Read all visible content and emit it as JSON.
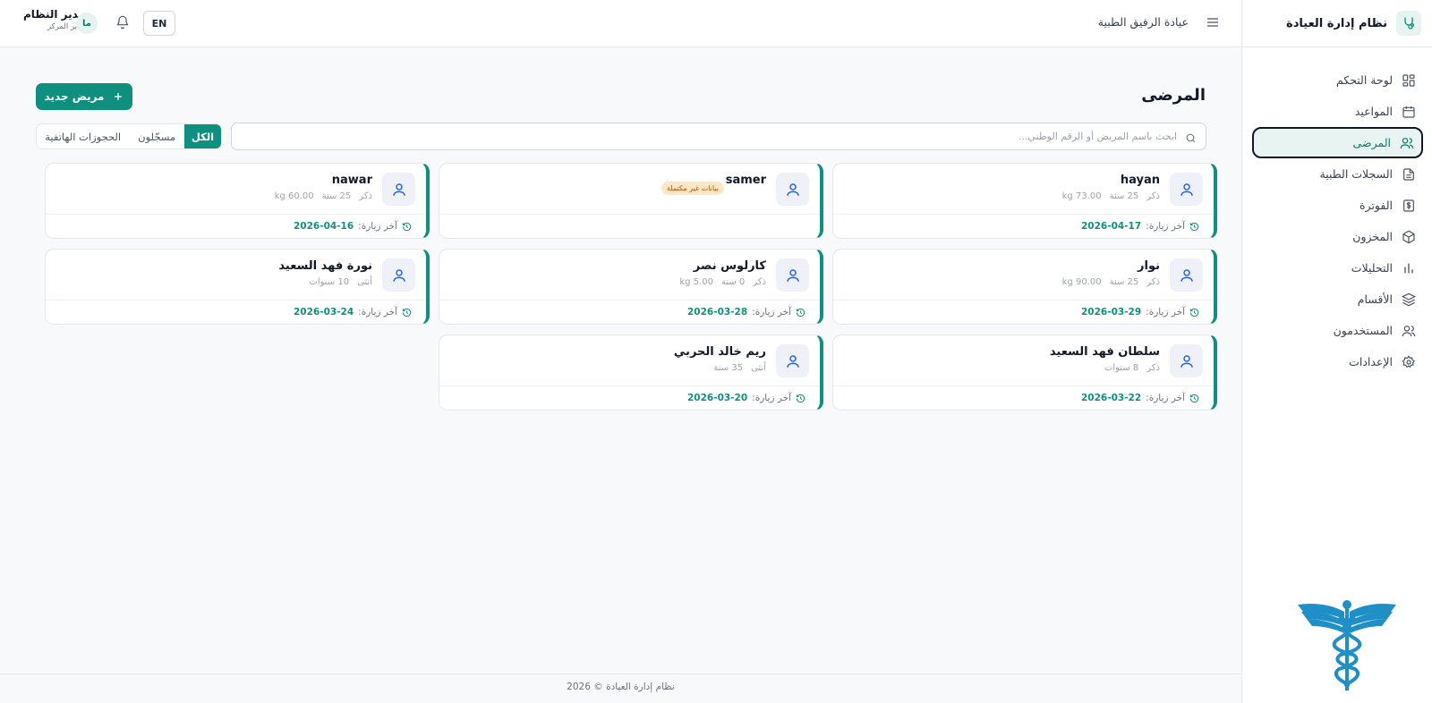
{
  "sidebar": {
    "app_title": "نظام إدارة العيادة",
    "items": [
      {
        "label": "لوحة التحكم",
        "icon": "dashboard-icon"
      },
      {
        "label": "المواعيد",
        "icon": "calendar-icon"
      },
      {
        "label": "المرضى",
        "icon": "users-icon",
        "active": true
      },
      {
        "label": "السجلات الطبية",
        "icon": "document-icon"
      },
      {
        "label": "الفوترة",
        "icon": "dollar-icon"
      },
      {
        "label": "المخزون",
        "icon": "box-icon"
      },
      {
        "label": "التحليلات",
        "icon": "bar-chart-icon"
      },
      {
        "label": "الأقسام",
        "icon": "layers-icon"
      },
      {
        "label": "المستخدمون",
        "icon": "users-icon"
      },
      {
        "label": "الإعدادات",
        "icon": "gear-icon"
      }
    ]
  },
  "header": {
    "clinic_name": "عيادة الرفيق الطبية",
    "lang_button": "EN",
    "user_name": "مدير النظام",
    "user_role": "مدير المركز",
    "avatar_initials": "ما"
  },
  "main": {
    "title": "المرضى",
    "new_patient_label": "مريض جديد",
    "search_placeholder": "ابحث باسم المريض أو الرقم الوطني...",
    "filters": {
      "all": "الكل",
      "registered": "مسجّلون",
      "phone": "الحجوزات الهاتفية"
    },
    "last_visit_label": "آخر زيارة:",
    "patients": [
      {
        "name": "hayan",
        "gender": "ذكر",
        "age": "25 سنة",
        "weight": "kg 73.00",
        "last_visit": "2026-04-17"
      },
      {
        "name": "samer",
        "badge": "بيانات غير مكتملة"
      },
      {
        "name": "nawar",
        "gender": "ذكر",
        "age": "25 سنة",
        "weight": "kg 60.00",
        "last_visit": "2026-04-16"
      },
      {
        "name": "نوار",
        "gender": "ذكر",
        "age": "25 سنة",
        "weight": "kg 90.00",
        "last_visit": "2026-03-29"
      },
      {
        "name": "كارلوس نصر",
        "gender": "ذكر",
        "age": "0 سنة",
        "weight": "kg 5.00",
        "last_visit": "2026-03-28"
      },
      {
        "name": "نورة فهد السعيد",
        "gender": "أنثى",
        "age": "10 سنوات",
        "last_visit": "2026-03-24"
      },
      {
        "name": "سلطان فهد السعيد",
        "gender": "ذكر",
        "age": "8 سنوات",
        "last_visit": "2026-03-22"
      },
      {
        "name": "ريم خالد الحربي",
        "gender": "أنثى",
        "age": "35 سنة",
        "last_visit": "2026-03-20"
      }
    ]
  },
  "footer": {
    "text": "نظام إدارة العيادة © 2026"
  },
  "colors": {
    "accent": "#0f8f7e",
    "badge_bg": "#fde7c5",
    "badge_text": "#b45309"
  }
}
